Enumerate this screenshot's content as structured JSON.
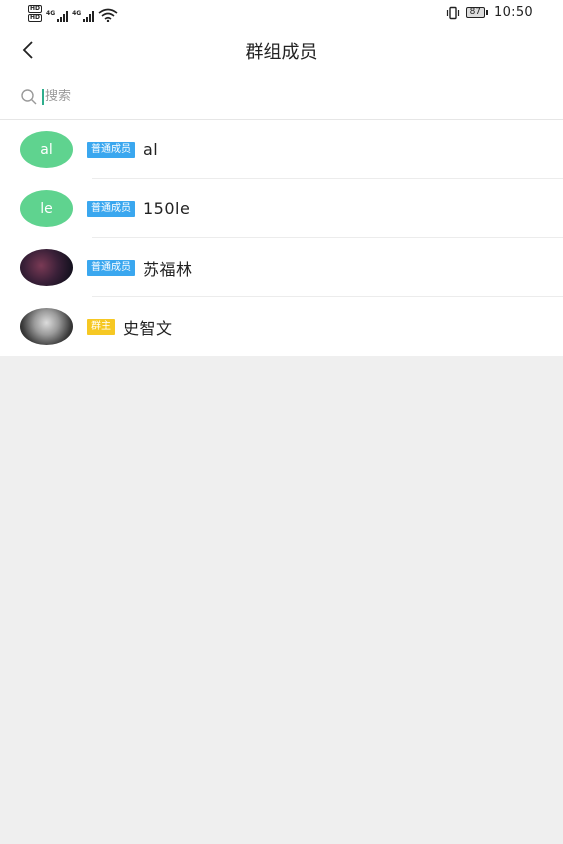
{
  "status_bar": {
    "hd": [
      "HD",
      "HD"
    ],
    "network": [
      "4G",
      "4G"
    ],
    "battery": "87",
    "time": "10:50"
  },
  "header": {
    "title": "群组成员"
  },
  "search": {
    "placeholder": "搜索"
  },
  "members": [
    {
      "avatar_text": "al",
      "badge": "普通成员",
      "name": "al"
    },
    {
      "avatar_text": "le",
      "badge": "普通成员",
      "name": "150le"
    },
    {
      "avatar_text": "",
      "badge": "普通成员",
      "name": "苏福林"
    },
    {
      "avatar_text": "",
      "badge": "群主",
      "name": "史智文"
    }
  ],
  "colors": {
    "avatar_green": "#5fd38f",
    "badge_member": "#3aa7ef",
    "badge_owner": "#f6c823",
    "caret": "#2fae8d",
    "background": "#efefef"
  }
}
